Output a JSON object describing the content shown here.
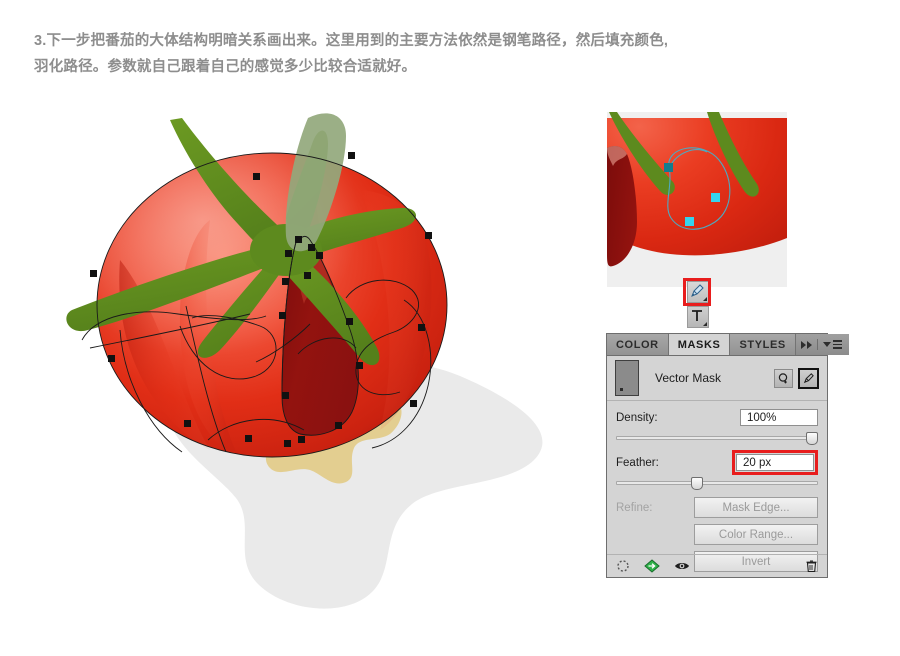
{
  "caption": {
    "line1": "3.下一步把番茄的大体结构明暗关系画出来。这里用到的主要方法依然是钢笔路径，然后填充颜色,",
    "line2": "羽化路径。参数就自己跟着自己的感觉多少比较合适就好。"
  },
  "artwork": {
    "title": "tomato-vector-illustration",
    "colors": {
      "body_light": "#f4634a",
      "body_mid": "#e8341b",
      "body_dark": "#c62011",
      "body_edge": "#b21a0d",
      "shadow_shape": "#8e1210",
      "stem_green": "#5d8a1e",
      "stem_highlight": "#93a87c",
      "ground_shadow": "#eaeaea",
      "tan_blob": "#e3ce90",
      "path_stroke": "#1a1a1a",
      "anchor_point": "#111111"
    }
  },
  "preview": {
    "title": "zoomed-path-preview",
    "anchor_color": "#35d3ee",
    "anchor_selected_color": "#127d8f",
    "path_color": "#4ea9c0"
  },
  "toolbar": {
    "pen_tool_label": "pen-tool",
    "type_tool_label": "type-tool",
    "highlight_color": "#e81d1d"
  },
  "panel": {
    "tabs": [
      {
        "label": "COLOR",
        "active": false
      },
      {
        "label": "MASKS",
        "active": true
      },
      {
        "label": "STYLES",
        "active": false
      }
    ],
    "expand_icon": "double-chevron-right-icon",
    "menu_icon": "panel-menu-icon",
    "mask_title": "Vector Mask",
    "header_buttons": [
      {
        "name": "add-pixel-mask-button",
        "selected": false
      },
      {
        "name": "add-vector-mask-button",
        "selected": true
      }
    ],
    "density": {
      "label": "Density:",
      "value": "100%",
      "slider_percent": 100,
      "highlighted": false
    },
    "feather": {
      "label": "Feather:",
      "value": "20 px",
      "slider_percent": 37,
      "highlighted": true,
      "highlight_color": "#e81d1d"
    },
    "refine": {
      "label": "Refine:",
      "disabled": true,
      "buttons": [
        {
          "label": "Mask Edge...",
          "name": "mask-edge-button"
        },
        {
          "label": "Color Range...",
          "name": "color-range-button"
        },
        {
          "label": "Invert",
          "name": "invert-button"
        }
      ]
    },
    "footer_icons": [
      {
        "name": "load-selection-icon",
        "glyph": "dotted-circle"
      },
      {
        "name": "apply-mask-icon",
        "glyph": "green-diamond-arrow"
      },
      {
        "name": "toggle-mask-visibility-icon",
        "glyph": "eye"
      },
      {
        "name": "delete-mask-icon",
        "glyph": "trash"
      }
    ]
  }
}
